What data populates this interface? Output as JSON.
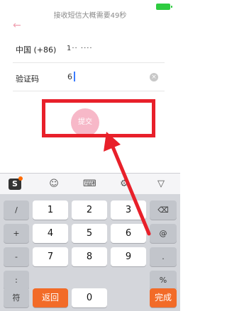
{
  "statusbar": {
    "battery_color": "#2ecc40"
  },
  "header": {
    "timer_hint": "接收短信大概需要49秒",
    "back_icon": "←"
  },
  "form": {
    "country_code": "中国 (+86)",
    "phone_value": "1··   ····",
    "code_label": "验证码",
    "code_value": "6",
    "clear_icon": "×",
    "submit_label": "提交"
  },
  "keyboard": {
    "toolbar": {
      "sogou": "S",
      "emoji": "☺",
      "keyboard": "⌨",
      "settings": "⚙",
      "hide": "▽"
    },
    "side_keys": [
      "/",
      "+",
      "-",
      ":"
    ],
    "digits": [
      "1",
      "2",
      "3",
      "4",
      "5",
      "6",
      "7",
      "8",
      "9",
      "0"
    ],
    "backspace": "⌫",
    "at": "@",
    "dot": ".",
    "percent": "%",
    "symbol": "符",
    "back": "返回",
    "done": "完成"
  },
  "colors": {
    "accent_red": "#e8202a",
    "submit_pink": "#f7b8c8",
    "keyboard_orange": "#f26b28"
  }
}
